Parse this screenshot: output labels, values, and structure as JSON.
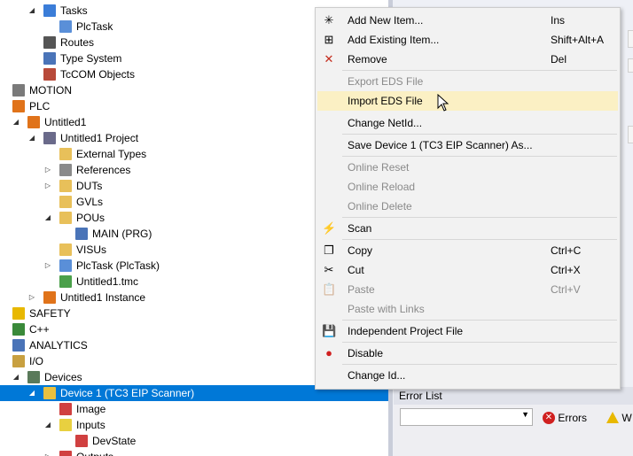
{
  "tree": [
    {
      "label": "Tasks",
      "indent": 2,
      "exp": "▲",
      "icon": "tasks-icon",
      "color": "#3b7dd8"
    },
    {
      "label": "PlcTask",
      "indent": 3,
      "exp": "",
      "icon": "task-icon",
      "color": "#5a8fd8"
    },
    {
      "label": "Routes",
      "indent": 2,
      "exp": "",
      "icon": "routes-icon",
      "color": "#555555"
    },
    {
      "label": "Type System",
      "indent": 2,
      "exp": "",
      "icon": "type-system-icon",
      "color": "#4a74b8"
    },
    {
      "label": "TcCOM Objects",
      "indent": 2,
      "exp": "",
      "icon": "tccom-objects-icon",
      "color": "#b84a3a"
    },
    {
      "label": "MOTION",
      "indent": 0,
      "exp": "",
      "icon": "motion-icon",
      "color": "#7a7a7a"
    },
    {
      "label": "PLC",
      "indent": 0,
      "exp": "",
      "icon": "plc-icon",
      "color": "#e0731a"
    },
    {
      "label": "Untitled1",
      "indent": 1,
      "exp": "▲",
      "icon": "plc-project-icon",
      "color": "#e0731a"
    },
    {
      "label": "Untitled1 Project",
      "indent": 2,
      "exp": "▲",
      "icon": "project-icon",
      "color": "#6a6a8a"
    },
    {
      "label": "External Types",
      "indent": 3,
      "exp": "",
      "icon": "folder-icon",
      "color": "#e8c05a"
    },
    {
      "label": "References",
      "indent": 3,
      "exp": "▷",
      "icon": "references-icon",
      "color": "#8a8a8a"
    },
    {
      "label": "DUTs",
      "indent": 3,
      "exp": "▷",
      "icon": "folder-icon",
      "color": "#e8c05a"
    },
    {
      "label": "GVLs",
      "indent": 3,
      "exp": "",
      "icon": "folder-icon",
      "color": "#e8c05a"
    },
    {
      "label": "POUs",
      "indent": 3,
      "exp": "▲",
      "icon": "folder-open-icon",
      "color": "#e8c05a"
    },
    {
      "label": "MAIN (PRG)",
      "indent": 4,
      "exp": "",
      "icon": "program-icon",
      "color": "#4a74b8"
    },
    {
      "label": "VISUs",
      "indent": 3,
      "exp": "",
      "icon": "folder-icon",
      "color": "#e8c05a"
    },
    {
      "label": "PlcTask (PlcTask)",
      "indent": 3,
      "exp": "▷",
      "icon": "task-icon",
      "color": "#5a8fd8"
    },
    {
      "label": "Untitled1.tmc",
      "indent": 3,
      "exp": "",
      "icon": "tmc-icon",
      "color": "#4aa04a"
    },
    {
      "label": "Untitled1 Instance",
      "indent": 2,
      "exp": "▷",
      "icon": "instance-icon",
      "color": "#e0731a"
    },
    {
      "label": "SAFETY",
      "indent": 0,
      "exp": "",
      "icon": "safety-icon",
      "color": "#e8b800"
    },
    {
      "label": "C++",
      "indent": 0,
      "exp": "",
      "icon": "cpp-icon",
      "color": "#3a8a3a"
    },
    {
      "label": "ANALYTICS",
      "indent": 0,
      "exp": "",
      "icon": "analytics-icon",
      "color": "#4a74b8"
    },
    {
      "label": "I/O",
      "indent": 0,
      "exp": "",
      "icon": "io-icon",
      "color": "#c8a040"
    },
    {
      "label": "Devices",
      "indent": 1,
      "exp": "▲",
      "icon": "devices-icon",
      "color": "#5a7a5a"
    },
    {
      "label": "Device 1 (TC3 EIP Scanner)",
      "indent": 2,
      "exp": "▲",
      "icon": "device-icon",
      "color": "#e8c040",
      "selected": true
    },
    {
      "label": "Image",
      "indent": 3,
      "exp": "",
      "icon": "image-icon",
      "color": "#d04040"
    },
    {
      "label": "Inputs",
      "indent": 3,
      "exp": "▲",
      "icon": "inputs-icon",
      "color": "#e8d040"
    },
    {
      "label": "DevState",
      "indent": 4,
      "exp": "",
      "icon": "variable-icon",
      "color": "#d04040"
    },
    {
      "label": "Outputs",
      "indent": 3,
      "exp": "▷",
      "icon": "outputs-icon",
      "color": "#d04040"
    }
  ],
  "menu": [
    {
      "type": "item",
      "label": "Add New Item...",
      "shortcut": "Ins",
      "icon": "add-new-item-icon",
      "glyph": "✳"
    },
    {
      "type": "item",
      "label": "Add Existing Item...",
      "shortcut": "Shift+Alt+A",
      "icon": "add-existing-item-icon",
      "glyph": "⊞"
    },
    {
      "type": "item",
      "label": "Remove",
      "shortcut": "Del",
      "icon": "remove-icon",
      "glyph": "✕",
      "glyphColor": "#c42b1c"
    },
    {
      "type": "sep"
    },
    {
      "type": "item",
      "label": "Export EDS File",
      "shortcut": "",
      "disabled": true
    },
    {
      "type": "item",
      "label": "Import EDS File",
      "shortcut": "",
      "highlight": true
    },
    {
      "type": "item",
      "label": "Change NetId...",
      "shortcut": ""
    },
    {
      "type": "sep"
    },
    {
      "type": "item",
      "label": "Save Device 1 (TC3 EIP Scanner) As...",
      "shortcut": ""
    },
    {
      "type": "sep"
    },
    {
      "type": "item",
      "label": "Online Reset",
      "shortcut": "",
      "disabled": true
    },
    {
      "type": "item",
      "label": "Online Reload",
      "shortcut": "",
      "disabled": true
    },
    {
      "type": "item",
      "label": "Online Delete",
      "shortcut": "",
      "disabled": true
    },
    {
      "type": "sep"
    },
    {
      "type": "item",
      "label": "Scan",
      "shortcut": "",
      "icon": "scan-icon",
      "glyph": "⚡"
    },
    {
      "type": "sep"
    },
    {
      "type": "item",
      "label": "Copy",
      "shortcut": "Ctrl+C",
      "icon": "copy-icon",
      "glyph": "❐"
    },
    {
      "type": "item",
      "label": "Cut",
      "shortcut": "Ctrl+X",
      "icon": "cut-icon",
      "glyph": "✂"
    },
    {
      "type": "item",
      "label": "Paste",
      "shortcut": "Ctrl+V",
      "disabled": true,
      "icon": "paste-icon",
      "glyph": "📋"
    },
    {
      "type": "item",
      "label": "Paste with Links",
      "shortcut": "",
      "disabled": true
    },
    {
      "type": "sep"
    },
    {
      "type": "item",
      "label": "Independent Project File",
      "shortcut": "",
      "icon": "save-icon",
      "glyph": "💾"
    },
    {
      "type": "sep"
    },
    {
      "type": "item",
      "label": "Disable",
      "shortcut": "",
      "icon": "disable-icon",
      "glyph": "●",
      "glyphColor": "#d02020"
    },
    {
      "type": "sep"
    },
    {
      "type": "item",
      "label": "Change Id...",
      "shortcut": ""
    }
  ],
  "errorList": {
    "title": "Error List",
    "errorsLabel": "Errors",
    "warningsLabel": "W"
  }
}
